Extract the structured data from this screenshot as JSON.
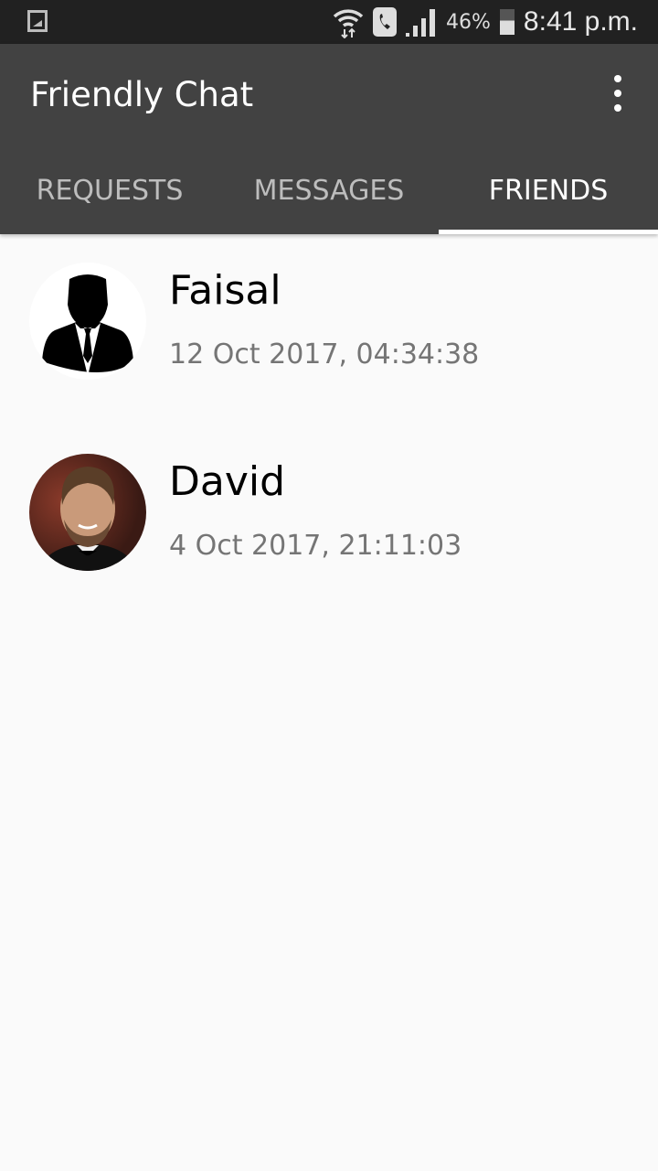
{
  "status_bar": {
    "battery_percent": "46%",
    "time": "8:41 p.m.",
    "icons": [
      "gallery-icon",
      "wifi-icon",
      "call-icon",
      "signal-icon",
      "battery-icon"
    ]
  },
  "app_bar": {
    "title": "Friendly Chat",
    "menu_icon": "more-vert-icon"
  },
  "tabs": [
    {
      "label": "REQUESTS",
      "active": false
    },
    {
      "label": "MESSAGES",
      "active": false
    },
    {
      "label": "FRIENDS",
      "active": true
    }
  ],
  "friends": [
    {
      "name": "Faisal",
      "timestamp": "12 Oct 2017, 04:34:38",
      "avatar": "default-silhouette"
    },
    {
      "name": "David",
      "timestamp": "4 Oct 2017, 21:11:03",
      "avatar": "photo"
    }
  ],
  "colors": {
    "status_bar": "#212121",
    "app_bar": "#424242",
    "background": "#fafafa",
    "timestamp": "#757575"
  }
}
